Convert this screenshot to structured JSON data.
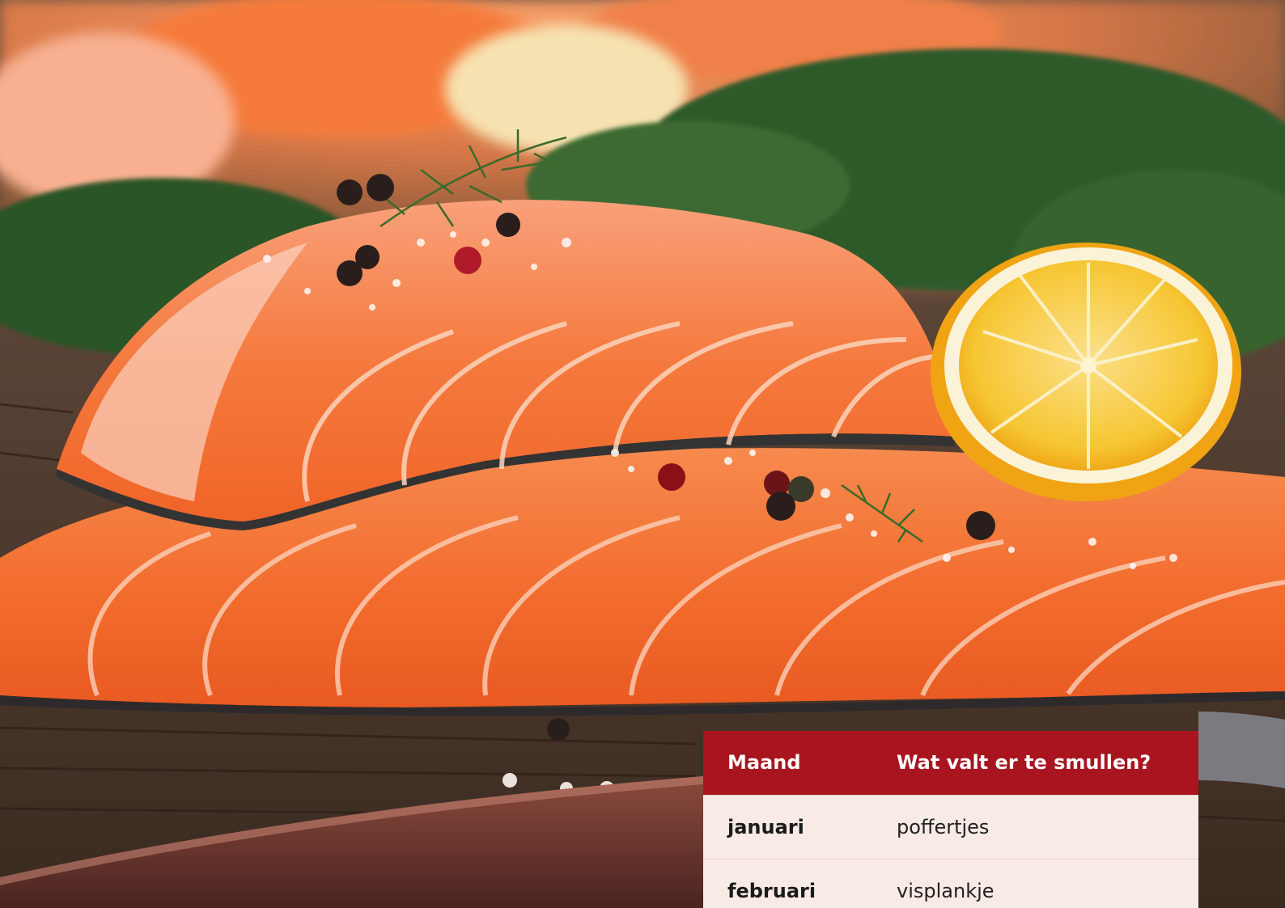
{
  "photo": {
    "subject": "salmon-fillets-with-lemon-dill-peppercorns-salt",
    "colors": {
      "salmon": "#f46a2a",
      "salmon_light": "#fbb08a",
      "lemon": "#f6c231",
      "dill": "#2f5a2a",
      "wood": "#5a4334"
    }
  },
  "table": {
    "header": {
      "month": "Maand",
      "dish": "Wat valt er te smullen?"
    },
    "rows": [
      {
        "month": "januari",
        "dish": "poffertjes"
      },
      {
        "month": "februari",
        "dish": "visplankje"
      }
    ],
    "colors": {
      "header_bg": "#a8151f",
      "row_bg": "#f8ebe5"
    }
  }
}
